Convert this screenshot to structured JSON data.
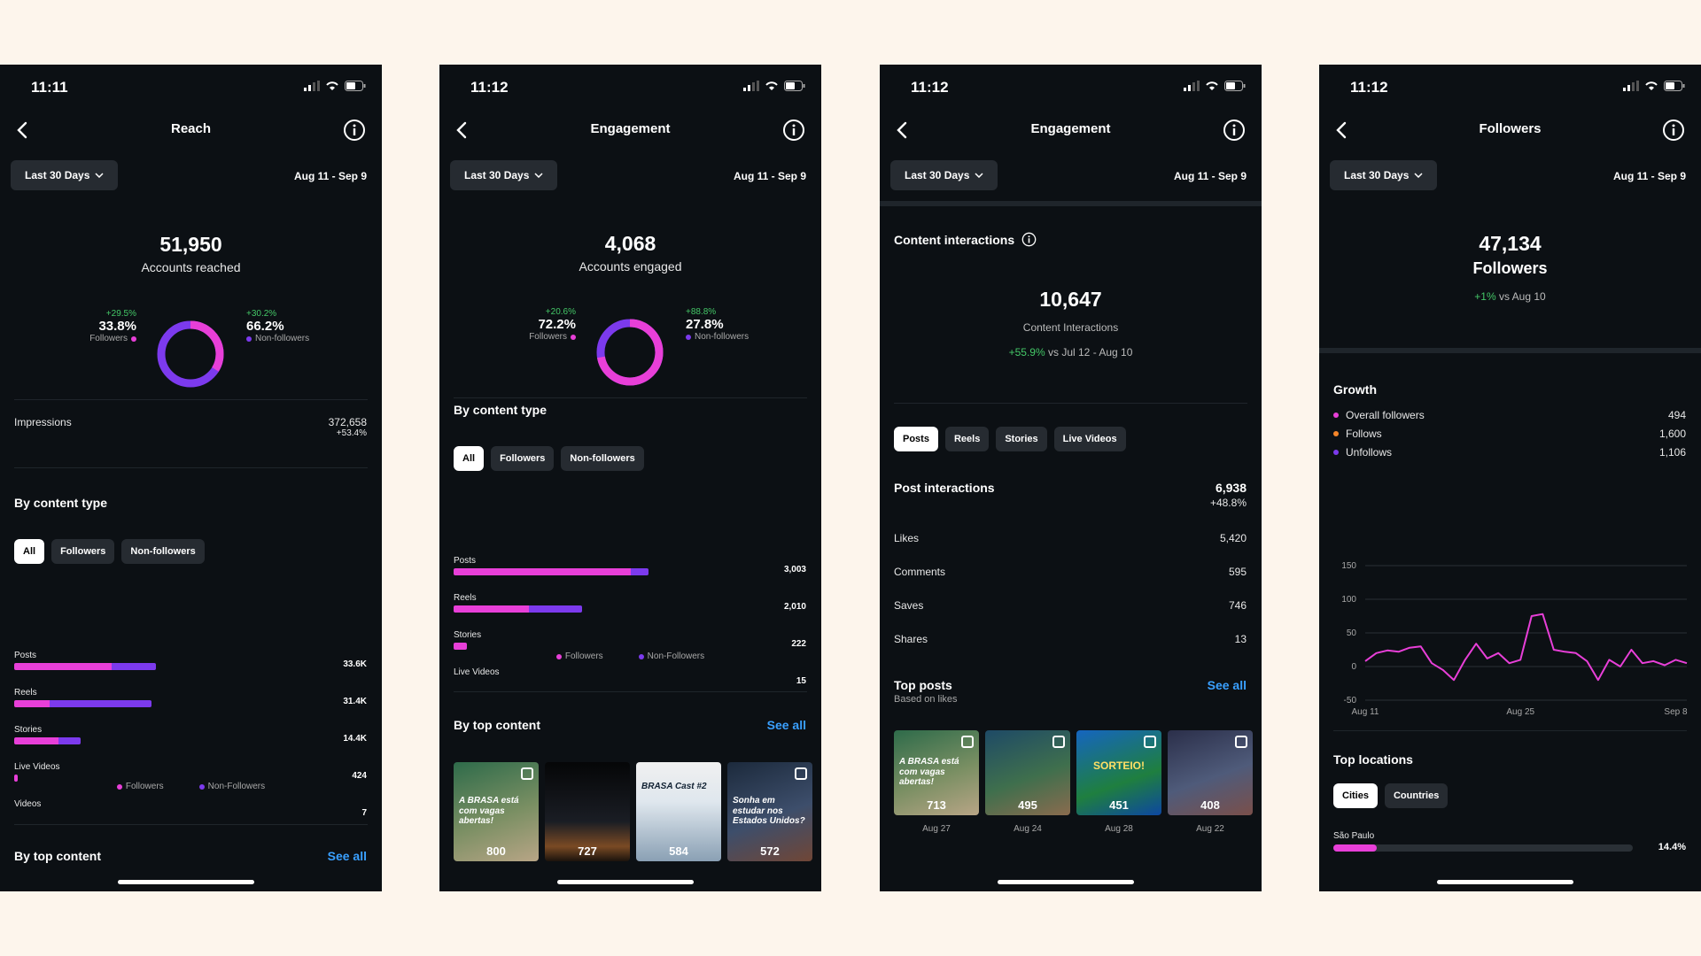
{
  "colors": {
    "followers": "#e83fd8",
    "non_followers": "#7c3aed",
    "positive": "#44c767",
    "link": "#3aa0ff"
  },
  "phones": [
    {
      "time": "11:11",
      "title": "Reach",
      "filter": "Last 30 Days",
      "range": "Aug 11 - Sep 9",
      "main_value": "51,950",
      "main_label": "Accounts reached",
      "followers": {
        "change": "+29.5%",
        "value": "33.8%",
        "label": "Followers",
        "fraction": 0.338
      },
      "non_followers": {
        "change": "+30.2%",
        "value": "66.2%",
        "label": "Non-followers"
      },
      "impressions_label": "Impressions",
      "impressions_value": "372,658",
      "impressions_change": "+53.4%",
      "content_type_title": "By content type",
      "filters": [
        "All",
        "Followers",
        "Non-followers"
      ],
      "bars": [
        {
          "label": "Posts",
          "value": "33.6K",
          "a": 0.22,
          "b": 0.1
        },
        {
          "label": "Reels",
          "value": "31.4K",
          "a": 0.08,
          "b": 0.23
        },
        {
          "label": "Stories",
          "value": "14.4K",
          "a": 0.1,
          "b": 0.05
        },
        {
          "label": "Live Videos",
          "value": "424",
          "a": 0.008,
          "b": 0
        },
        {
          "label": "Videos",
          "value": "7",
          "a": 0,
          "b": 0
        }
      ],
      "legend": [
        "Followers",
        "Non-Followers"
      ],
      "top_content_title": "By top content",
      "see_all": "See all"
    },
    {
      "time": "11:12",
      "title": "Engagement",
      "filter": "Last 30 Days",
      "range": "Aug 11 - Sep 9",
      "main_value": "4,068",
      "main_label": "Accounts engaged",
      "followers": {
        "change": "+20.6%",
        "value": "72.2%",
        "label": "Followers",
        "fraction": 0.722
      },
      "non_followers": {
        "change": "+88.8%",
        "value": "27.8%",
        "label": "Non-followers"
      },
      "content_type_title": "By content type",
      "filters": [
        "All",
        "Followers",
        "Non-followers"
      ],
      "bars": [
        {
          "label": "Posts",
          "value": "3,003",
          "a": 0.4,
          "b": 0.04
        },
        {
          "label": "Reels",
          "value": "2,010",
          "a": 0.17,
          "b": 0.12
        },
        {
          "label": "Stories",
          "value": "222",
          "a": 0.03,
          "b": 0
        },
        {
          "label": "Live Videos",
          "value": "15",
          "a": 0,
          "b": 0
        }
      ],
      "legend": [
        "Followers",
        "Non-Followers"
      ],
      "top_content_title": "By top content",
      "see_all": "See all",
      "thumbs": [
        {
          "num": "800",
          "text": "A BRASA está com vagas abertas!"
        },
        {
          "num": "727",
          "text": ""
        },
        {
          "num": "584",
          "text": "BRASA Cast #2"
        },
        {
          "num": "572",
          "text": "Sonha em estudar nos Estados Unidos?"
        }
      ]
    },
    {
      "time": "11:12",
      "title": "Engagement",
      "filter": "Last 30 Days",
      "range": "Aug 11 - Sep 9",
      "ci_title": "Content interactions",
      "main_value": "10,647",
      "main_label": "Content Interactions",
      "change": "+55.9%",
      "change_ref": "vs Jul 12 - Aug 10",
      "filters": [
        "Posts",
        "Reels",
        "Stories",
        "Live Videos"
      ],
      "post_title": "Post interactions",
      "post_value": "6,938",
      "post_change": "+48.8%",
      "metrics": [
        {
          "label": "Likes",
          "value": "5,420"
        },
        {
          "label": "Comments",
          "value": "595"
        },
        {
          "label": "Saves",
          "value": "746"
        },
        {
          "label": "Shares",
          "value": "13"
        }
      ],
      "top_posts_title": "Top posts",
      "top_posts_sub": "Based on likes",
      "see_all": "See all",
      "thumbs": [
        {
          "num": "713",
          "date": "Aug 27",
          "text": "A BRASA está com vagas abertas!"
        },
        {
          "num": "495",
          "date": "Aug 24",
          "text": ""
        },
        {
          "num": "451",
          "date": "Aug 28",
          "text": "SORTEIO!"
        },
        {
          "num": "408",
          "date": "Aug 22",
          "text": ""
        }
      ]
    },
    {
      "time": "11:12",
      "title": "Followers",
      "filter": "Last 30 Days",
      "range": "Aug 11 - Sep 9",
      "main_value": "47,134",
      "main_label": "Followers",
      "change": "+1%",
      "change_ref": "vs Aug 10",
      "growth_title": "Growth",
      "growth": [
        {
          "label": "Overall followers",
          "value": "494",
          "color": "#e83fd8"
        },
        {
          "label": "Follows",
          "value": "1,600",
          "color": "#f58529"
        },
        {
          "label": "Unfollows",
          "value": "1,106",
          "color": "#7c3aed"
        }
      ],
      "top_locations_title": "Top locations",
      "loc_filters": [
        "Cities",
        "Countries"
      ],
      "location": {
        "label": "São Paulo",
        "value": "14.4%",
        "fraction": 0.144
      }
    }
  ],
  "chart_data": {
    "type": "line",
    "x": [
      "Aug 11",
      "Aug 12",
      "Aug 13",
      "Aug 14",
      "Aug 15",
      "Aug 16",
      "Aug 17",
      "Aug 18",
      "Aug 19",
      "Aug 20",
      "Aug 21",
      "Aug 22",
      "Aug 23",
      "Aug 24",
      "Aug 25",
      "Aug 26",
      "Aug 27",
      "Aug 28",
      "Aug 29",
      "Aug 30",
      "Aug 31",
      "Sep 1",
      "Sep 2",
      "Sep 3",
      "Sep 4",
      "Sep 5",
      "Sep 6",
      "Sep 7",
      "Sep 8",
      "Sep 9"
    ],
    "series": [
      {
        "values": [
          8,
          20,
          24,
          22,
          28,
          30,
          5,
          -5,
          -20,
          10,
          34,
          12,
          20,
          5,
          10,
          75,
          78,
          25,
          22,
          20,
          8,
          -20,
          10,
          0,
          25,
          5,
          8,
          2,
          10,
          5
        ]
      }
    ],
    "x_tick_labels": [
      "Aug 11",
      "Aug 25",
      "Sep 8"
    ],
    "y_ticks": [
      150,
      100,
      50,
      0,
      -50
    ],
    "ylim": [
      -50,
      150
    ],
    "grid": true
  }
}
